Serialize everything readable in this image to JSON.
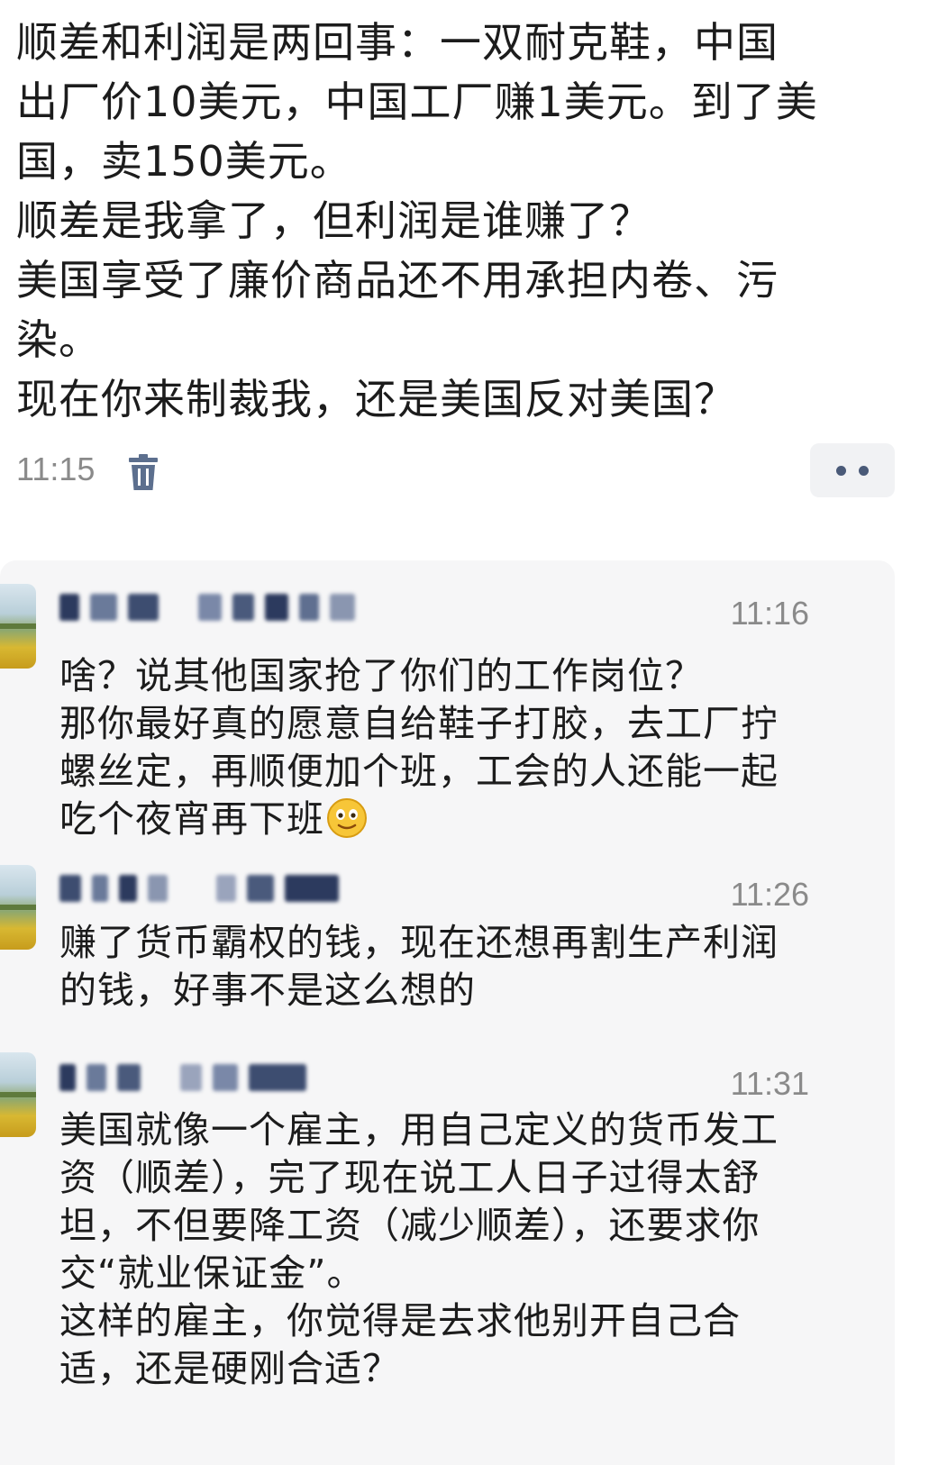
{
  "post": {
    "lines": [
      "顺差和利润是两回事：一双耐克鞋，中国",
      "出厂价10美元，中国工厂赚1美元。到了美",
      "国，卖150美元。",
      "顺差是我拿了，但利润是谁赚了？",
      "美国享受了廉价商品还不用承担内卷、污",
      "染。",
      "现在你来制裁我，还是美国反对美国？"
    ],
    "time": "11:15",
    "delete_icon": "trash-icon",
    "more_icon": "more-dots-icon"
  },
  "comments": [
    {
      "time": "11:16",
      "lines": [
        "啥？说其他国家抢了你们的工作岗位？",
        "那你最好真的愿意自给鞋子打胶，去工厂拧",
        "螺丝定，再顺便加个班，工会的人还能一起",
        "吃个夜宵再下班"
      ],
      "emoji": "smiling-face-emoji"
    },
    {
      "time": "11:26",
      "lines": [
        "赚了货币霸权的钱，现在还想再割生产利润",
        "的钱，好事不是这么想的"
      ]
    },
    {
      "time": "11:31",
      "lines": [
        "美国就像一个雇主，用自己定义的货币发工",
        "资（顺差），完了现在说工人日子过得太舒",
        "坦，不但要降工资（减少顺差），还要求你",
        "交“就业保证金”。",
        "这样的雇主，你觉得是去求他别开自己合",
        "适，还是硬刚合适？"
      ]
    }
  ]
}
